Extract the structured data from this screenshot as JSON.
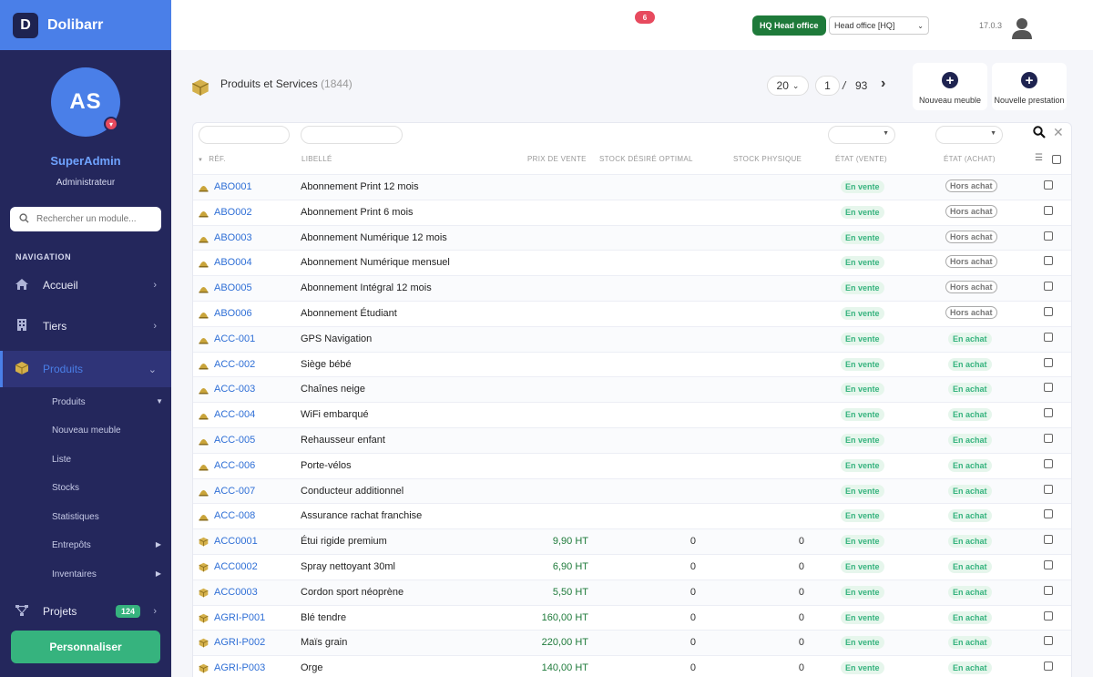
{
  "brand": {
    "name": "Dolibarr",
    "logo_letter": "D"
  },
  "user": {
    "initials": "AS",
    "name": "SuperAdmin",
    "role": "Administrateur"
  },
  "sidebar": {
    "search_placeholder": "Rechercher un module...",
    "nav_title": "NAVIGATION",
    "items": [
      {
        "label": "Accueil",
        "icon": "home-icon"
      },
      {
        "label": "Tiers",
        "icon": "building-icon"
      },
      {
        "label": "Produits",
        "icon": "box-icon"
      },
      {
        "label": "Projets",
        "icon": "sitemap-icon",
        "badge": "124"
      }
    ],
    "sub_items": [
      {
        "label": "Produits"
      },
      {
        "label": "Nouveau meuble"
      },
      {
        "label": "Liste"
      },
      {
        "label": "Stocks"
      },
      {
        "label": "Statistiques"
      },
      {
        "label": "Entrepôts"
      },
      {
        "label": "Inventaires"
      }
    ],
    "personalize_label": "Personnaliser"
  },
  "topbar": {
    "notification_count": "6",
    "entity_badge": "HQ Head office",
    "entity_select": "Head office [HQ]",
    "version": "17.0.3"
  },
  "page": {
    "title": "Produits et Services",
    "count": "(1844)",
    "page_size": "20",
    "current_page": "1",
    "separator": "/",
    "total_pages": "93",
    "actions": [
      {
        "label": "Nouveau meuble"
      },
      {
        "label": "Nouvelle prestation"
      }
    ]
  },
  "table": {
    "headers": {
      "ref": "RÉF.",
      "libelle": "LIBELLÉ",
      "prix": "PRIX DE VENTE",
      "stock_desire": "STOCK DÉSIRÉ OPTIMAL",
      "stock_physique": "STOCK PHYSIQUE",
      "etat_vente": "ÉTAT (VENTE)",
      "etat_achat": "ÉTAT (ACHAT)"
    },
    "rows": [
      {
        "ref": "ABO001",
        "libelle": "Abonnement Print 12 mois",
        "prix": "",
        "sdo": "",
        "sph": "",
        "vente": "En vente",
        "achat": "Hors achat",
        "type": "service"
      },
      {
        "ref": "ABO002",
        "libelle": "Abonnement Print 6 mois",
        "prix": "",
        "sdo": "",
        "sph": "",
        "vente": "En vente",
        "achat": "Hors achat",
        "type": "service"
      },
      {
        "ref": "ABO003",
        "libelle": "Abonnement Numérique 12 mois",
        "prix": "",
        "sdo": "",
        "sph": "",
        "vente": "En vente",
        "achat": "Hors achat",
        "type": "service"
      },
      {
        "ref": "ABO004",
        "libelle": "Abonnement Numérique mensuel",
        "prix": "",
        "sdo": "",
        "sph": "",
        "vente": "En vente",
        "achat": "Hors achat",
        "type": "service"
      },
      {
        "ref": "ABO005",
        "libelle": "Abonnement Intégral 12 mois",
        "prix": "",
        "sdo": "",
        "sph": "",
        "vente": "En vente",
        "achat": "Hors achat",
        "type": "service"
      },
      {
        "ref": "ABO006",
        "libelle": "Abonnement Étudiant",
        "prix": "",
        "sdo": "",
        "sph": "",
        "vente": "En vente",
        "achat": "Hors achat",
        "type": "service"
      },
      {
        "ref": "ACC-001",
        "libelle": "GPS Navigation",
        "prix": "",
        "sdo": "",
        "sph": "",
        "vente": "En vente",
        "achat": "En achat",
        "type": "service"
      },
      {
        "ref": "ACC-002",
        "libelle": "Siège bébé",
        "prix": "",
        "sdo": "",
        "sph": "",
        "vente": "En vente",
        "achat": "En achat",
        "type": "service"
      },
      {
        "ref": "ACC-003",
        "libelle": "Chaînes neige",
        "prix": "",
        "sdo": "",
        "sph": "",
        "vente": "En vente",
        "achat": "En achat",
        "type": "service"
      },
      {
        "ref": "ACC-004",
        "libelle": "WiFi embarqué",
        "prix": "",
        "sdo": "",
        "sph": "",
        "vente": "En vente",
        "achat": "En achat",
        "type": "service"
      },
      {
        "ref": "ACC-005",
        "libelle": "Rehausseur enfant",
        "prix": "",
        "sdo": "",
        "sph": "",
        "vente": "En vente",
        "achat": "En achat",
        "type": "service"
      },
      {
        "ref": "ACC-006",
        "libelle": "Porte-vélos",
        "prix": "",
        "sdo": "",
        "sph": "",
        "vente": "En vente",
        "achat": "En achat",
        "type": "service"
      },
      {
        "ref": "ACC-007",
        "libelle": "Conducteur additionnel",
        "prix": "",
        "sdo": "",
        "sph": "",
        "vente": "En vente",
        "achat": "En achat",
        "type": "service"
      },
      {
        "ref": "ACC-008",
        "libelle": "Assurance rachat franchise",
        "prix": "",
        "sdo": "",
        "sph": "",
        "vente": "En vente",
        "achat": "En achat",
        "type": "service"
      },
      {
        "ref": "ACC0001",
        "libelle": "Étui rigide premium",
        "prix": "9,90 HT",
        "sdo": "0",
        "sph": "0",
        "vente": "En vente",
        "achat": "En achat",
        "type": "product"
      },
      {
        "ref": "ACC0002",
        "libelle": "Spray nettoyant 30ml",
        "prix": "6,90 HT",
        "sdo": "0",
        "sph": "0",
        "vente": "En vente",
        "achat": "En achat",
        "type": "product"
      },
      {
        "ref": "ACC0003",
        "libelle": "Cordon sport néoprène",
        "prix": "5,50 HT",
        "sdo": "0",
        "sph": "0",
        "vente": "En vente",
        "achat": "En achat",
        "type": "product"
      },
      {
        "ref": "AGRI-P001",
        "libelle": "Blé tendre",
        "prix": "160,00 HT",
        "sdo": "0",
        "sph": "0",
        "vente": "En vente",
        "achat": "En achat",
        "type": "product"
      },
      {
        "ref": "AGRI-P002",
        "libelle": "Maïs grain",
        "prix": "220,00 HT",
        "sdo": "0",
        "sph": "0",
        "vente": "En vente",
        "achat": "En achat",
        "type": "product"
      },
      {
        "ref": "AGRI-P003",
        "libelle": "Orge",
        "prix": "140,00 HT",
        "sdo": "0",
        "sph": "0",
        "vente": "En vente",
        "achat": "En achat",
        "type": "product"
      }
    ]
  },
  "colors": {
    "sidebar": "#24275c",
    "brand": "#4a7fe8",
    "accent_green": "#36b37e",
    "link": "#2f6fd6"
  }
}
